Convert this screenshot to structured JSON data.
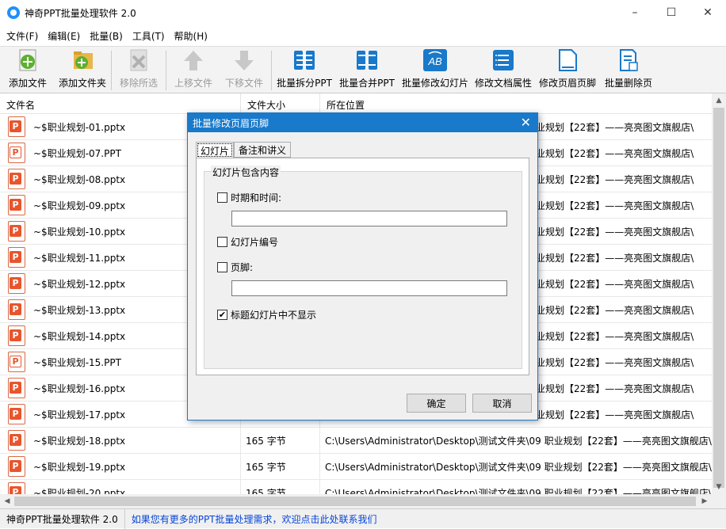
{
  "window": {
    "title": "神奇PPT批量处理软件 2.0"
  },
  "menu": [
    "文件(F)",
    "编辑(E)",
    "批量(B)",
    "工具(T)",
    "帮助(H)"
  ],
  "toolbar": [
    {
      "label": "添加文件",
      "icon": "add-file-icon",
      "disabled": false
    },
    {
      "label": "添加文件夹",
      "icon": "add-folder-icon",
      "disabled": false
    },
    {
      "label": "移除所选",
      "icon": "remove-icon",
      "disabled": true
    },
    {
      "label": "上移文件",
      "icon": "arrow-up-icon",
      "disabled": true
    },
    {
      "label": "下移文件",
      "icon": "arrow-down-icon",
      "disabled": true
    },
    {
      "label": "批量拆分PPT",
      "icon": "split-icon",
      "disabled": false
    },
    {
      "label": "批量合并PPT",
      "icon": "merge-icon",
      "disabled": false
    },
    {
      "label": "批量修改幻灯片",
      "icon": "ab-slide-icon",
      "disabled": false
    },
    {
      "label": "修改文档属性",
      "icon": "properties-icon",
      "disabled": false
    },
    {
      "label": "修改页眉页脚",
      "icon": "header-footer-icon",
      "disabled": false
    },
    {
      "label": "批量删除页",
      "icon": "delete-page-icon",
      "disabled": false
    }
  ],
  "columns": [
    "文件名",
    "文件大小",
    "所在位置"
  ],
  "rows": [
    {
      "name": "~$职业规划-01.pptx",
      "size": "",
      "path": "业规划【22套】——亮亮图文旗舰店\\",
      "old": false
    },
    {
      "name": "~$职业规划-07.PPT",
      "size": "",
      "path": "业规划【22套】——亮亮图文旗舰店\\",
      "old": true
    },
    {
      "name": "~$职业规划-08.pptx",
      "size": "",
      "path": "业规划【22套】——亮亮图文旗舰店\\",
      "old": false
    },
    {
      "name": "~$职业规划-09.pptx",
      "size": "",
      "path": "业规划【22套】——亮亮图文旗舰店\\",
      "old": false
    },
    {
      "name": "~$职业规划-10.pptx",
      "size": "",
      "path": "业规划【22套】——亮亮图文旗舰店\\",
      "old": false
    },
    {
      "name": "~$职业规划-11.pptx",
      "size": "",
      "path": "业规划【22套】——亮亮图文旗舰店\\",
      "old": false
    },
    {
      "name": "~$职业规划-12.pptx",
      "size": "",
      "path": "业规划【22套】——亮亮图文旗舰店\\",
      "old": false
    },
    {
      "name": "~$职业规划-13.pptx",
      "size": "",
      "path": "业规划【22套】——亮亮图文旗舰店\\",
      "old": false
    },
    {
      "name": "~$职业规划-14.pptx",
      "size": "",
      "path": "业规划【22套】——亮亮图文旗舰店\\",
      "old": false
    },
    {
      "name": "~$职业规划-15.PPT",
      "size": "",
      "path": "业规划【22套】——亮亮图文旗舰店\\",
      "old": true
    },
    {
      "name": "~$职业规划-16.pptx",
      "size": "",
      "path": "业规划【22套】——亮亮图文旗舰店\\",
      "old": false
    },
    {
      "name": "~$职业规划-17.pptx",
      "size": "",
      "path": "业规划【22套】——亮亮图文旗舰店\\",
      "old": false
    },
    {
      "name": "~$职业规划-18.pptx",
      "size": "165 字节",
      "path": "C:\\Users\\Administrator\\Desktop\\测试文件夹\\09 职业规划【22套】——亮亮图文旗舰店\\",
      "old": false
    },
    {
      "name": "~$职业规划-19.pptx",
      "size": "165 字节",
      "path": "C:\\Users\\Administrator\\Desktop\\测试文件夹\\09 职业规划【22套】——亮亮图文旗舰店\\",
      "old": false
    },
    {
      "name": "~$职业规划-20.pptx",
      "size": "165 字节",
      "path": "C:\\Users\\Administrator\\Desktop\\测试文件夹\\09 职业规划【22套】——亮亮图文旗舰店\\",
      "old": false
    }
  ],
  "dialog": {
    "title": "批量修改页眉页脚",
    "tabs": [
      "幻灯片",
      "备注和讲义"
    ],
    "group_title": "幻灯片包含内容",
    "date_time": {
      "label": "时期和时间:",
      "checked": false,
      "value": ""
    },
    "slide_number": {
      "label": "幻灯片编号",
      "checked": false
    },
    "footer": {
      "label": "页脚:",
      "checked": false,
      "value": ""
    },
    "hide_title": {
      "label": "标题幻灯片中不显示",
      "checked": true
    },
    "ok": "确定",
    "cancel": "取消"
  },
  "status": {
    "app": "神奇PPT批量处理软件 2.0",
    "link": "如果您有更多的PPT批量处理需求，欢迎点击此处联系我们"
  },
  "colors": {
    "accent": "#1979ca",
    "ppt": "#e8552d",
    "link": "#0645d8"
  }
}
